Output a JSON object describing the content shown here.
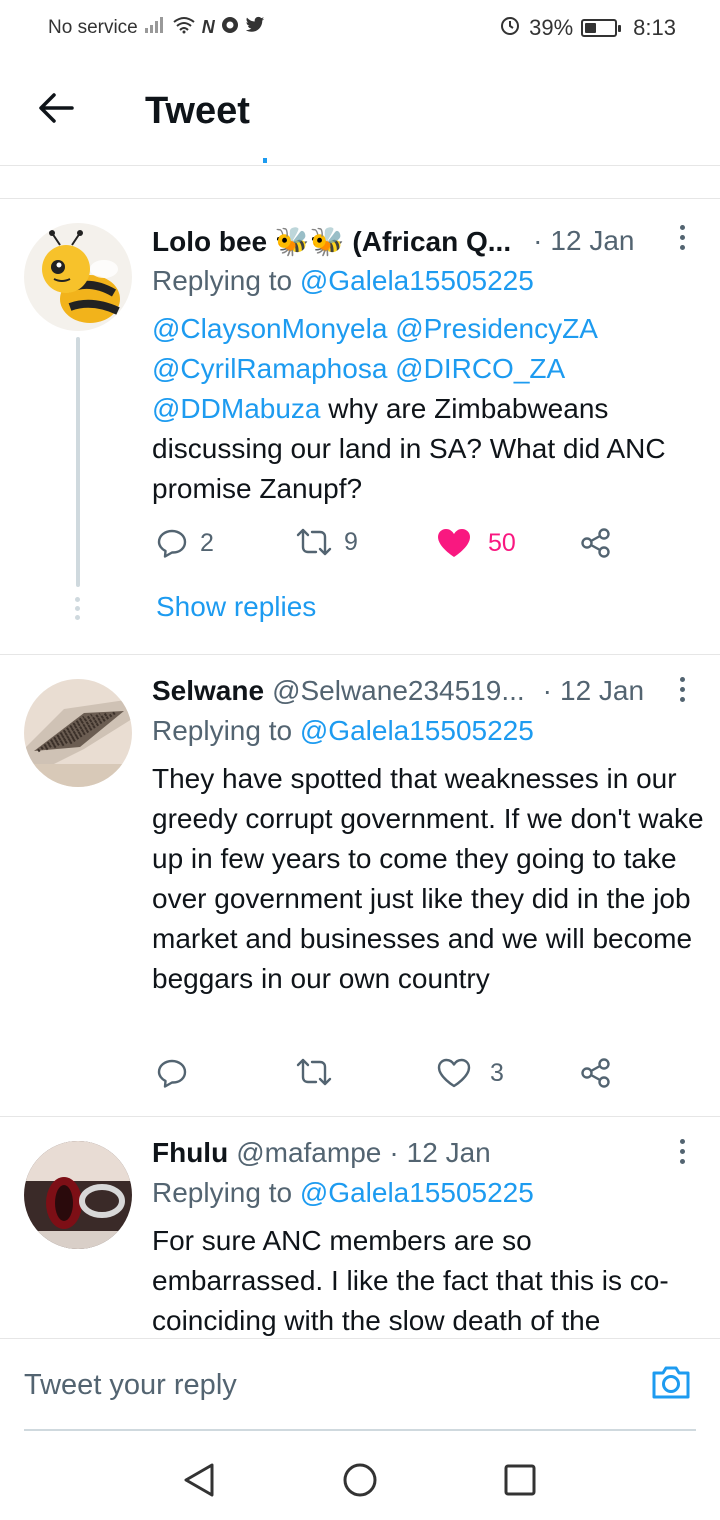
{
  "status_bar": {
    "carrier": "No service",
    "battery_percent": "39%",
    "battery_level": 0.39,
    "time": "8:13"
  },
  "header": {
    "title": "Tweet"
  },
  "tweets": [
    {
      "name": "Lolo bee 🐝🐝 (African Q...",
      "handle": "",
      "dot": "·",
      "time": "12 Jan",
      "replying_prefix": "Replying to",
      "replying_to": "@Galela15505225",
      "mentions_line1": "@ClaysonMonyela @PresidencyZA",
      "mentions_line2": "@CyrilRamaphosa @DIRCO_ZA",
      "mentions_line3_mention": "@DDMabuza",
      "mentions_line3_text": " why are Zimbabweans",
      "body_rest": "discussing our land in SA?  What did ANC promise Zanupf?",
      "replies": "2",
      "retweets": "9",
      "likes": "50",
      "show_replies": "Show replies"
    },
    {
      "name": "Selwane",
      "handle": "@Selwane234519...",
      "dot": "·",
      "time": "12 Jan",
      "replying_prefix": "Replying to",
      "replying_to": "@Galela15505225",
      "body": "They have spotted that weaknesses in our greedy corrupt government. If we don't wake up in few years to come they going to take over government just like they did in the job market and businesses and we will become beggars in our own country",
      "replies": "",
      "retweets": "",
      "likes": "3"
    },
    {
      "name": "Fhulu",
      "handle": "@mafampe",
      "dot": "·",
      "time": "12 Jan",
      "replying_prefix": "Replying to",
      "replying_to": "@Galela15505225",
      "body": "For sure ANC members are so embarrassed. I like the fact that this is co-coinciding with the slow death of the"
    }
  ],
  "compose": {
    "placeholder": "Tweet your reply"
  },
  "colors": {
    "accent": "#1d9bf0",
    "like": "#f91880",
    "muted": "#536471"
  },
  "icons": [
    "back-arrow-icon",
    "reply-icon",
    "retweet-icon",
    "like-icon",
    "share-icon",
    "more-icon",
    "camera-icon",
    "nav-back-icon",
    "nav-home-icon",
    "nav-recents-icon"
  ]
}
